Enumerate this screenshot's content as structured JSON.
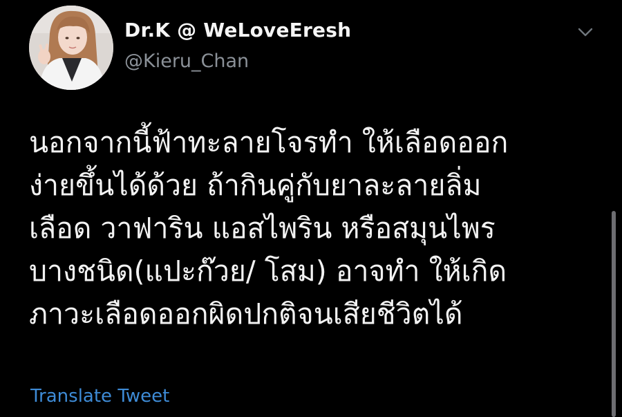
{
  "tweet": {
    "author": {
      "display_name": "Dr.K @ WeLoveEresh",
      "handle": "@Kieru_Chan"
    },
    "avatar_icon": "avatar-photo",
    "menu_icon": "chevron-down-icon",
    "text_lines": [
      "นอกจากนี้ฟ้าทะลายโจรทำ ให้เลือดออก",
      "ง่ายขึ้นได้ด้วย ถ้ากินคู่กับยาละลายลิ่ม",
      "เลือด วาฟาริน แอสไพริน หรือสมุนไพร",
      "บางชนิด(แปะก๊วย/ โสม) อาจทำ ให้เกิด",
      "ภาวะเลือดออกผิดปกติจนเสียชีวิตได้"
    ],
    "translate_label": "Translate Tweet"
  },
  "colors": {
    "background": "#000000",
    "text": "#f2f2f2",
    "secondary_text": "#8b9198",
    "link": "#3e8bd6",
    "scrollbar": "#6e6e72"
  }
}
